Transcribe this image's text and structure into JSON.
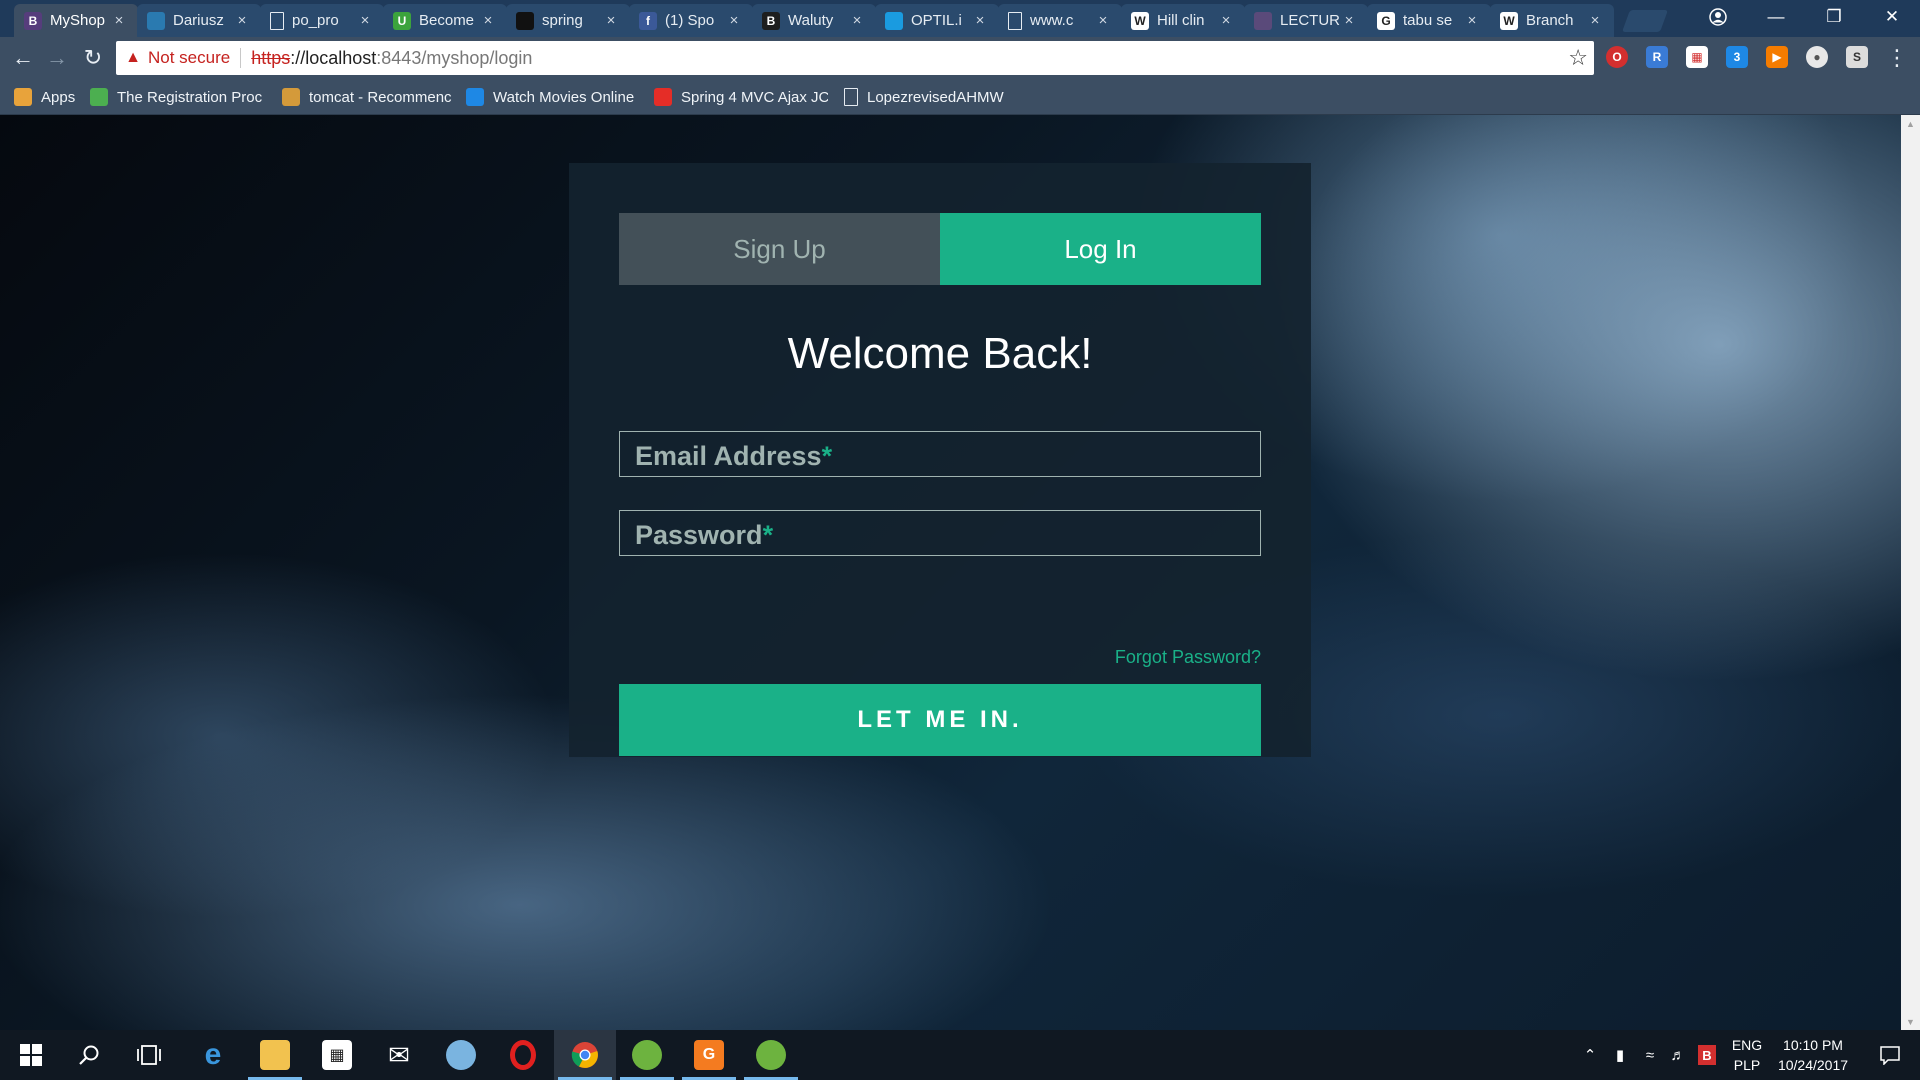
{
  "browser": {
    "tabs": [
      {
        "title": "MyShop",
        "icon": "bootstrap-icon",
        "icon_text": "B",
        "icon_color": "#563d7c",
        "active": true
      },
      {
        "title": "Dariusz",
        "icon": "profile-photo-icon",
        "icon_text": "",
        "icon_color": "#2a7ab0",
        "active": false
      },
      {
        "title": "po_pro",
        "icon": "document-icon",
        "icon_text": "",
        "icon_color": "",
        "active": false
      },
      {
        "title": "Become",
        "icon": "udemy-icon",
        "icon_text": "U",
        "icon_color": "#3ca33c",
        "active": false
      },
      {
        "title": "spring",
        "icon": "github-icon",
        "icon_text": "",
        "icon_color": "#111111",
        "active": false
      },
      {
        "title": "(1) Spo",
        "icon": "facebook-icon",
        "icon_text": "f",
        "icon_color": "#3b5998",
        "active": false
      },
      {
        "title": "Waluty",
        "icon": "bootstrap-icon",
        "icon_text": "B",
        "icon_color": "#1e1e1e",
        "active": false
      },
      {
        "title": "OPTIL.i",
        "icon": "optil-icon",
        "icon_text": "",
        "icon_color": "#1a9be0",
        "active": false
      },
      {
        "title": "www.c",
        "icon": "document-icon",
        "icon_text": "",
        "icon_color": "",
        "active": false
      },
      {
        "title": "Hill clin",
        "icon": "wikipedia-icon",
        "icon_text": "W",
        "icon_color": "#ffffff",
        "active": false
      },
      {
        "title": "LECTUR",
        "icon": "lecture-icon",
        "icon_text": "",
        "icon_color": "#5a4a7a",
        "active": false
      },
      {
        "title": "tabu se",
        "icon": "google-icon",
        "icon_text": "G",
        "icon_color": "#ffffff",
        "active": false
      },
      {
        "title": "Branch",
        "icon": "wikipedia-icon",
        "icon_text": "W",
        "icon_color": "#ffffff",
        "active": false
      }
    ],
    "close_glyph": "×",
    "address": {
      "security_label": "Not secure",
      "url_scheme": "https",
      "url_host": "://localhost",
      "url_rest": ":8443/myshop/login"
    },
    "bookmarks": [
      {
        "label": "Apps",
        "icon": "apps-grid-icon",
        "color": "#e8a33b"
      },
      {
        "label": "The Registration Proc",
        "icon": "registration-icon",
        "color": "#4caf50"
      },
      {
        "label": "tomcat - Recommenc",
        "icon": "tomcat-icon",
        "color": "#d49a3a"
      },
      {
        "label": "Watch Movies Online",
        "icon": "movies-icon",
        "color": "#1e88e5"
      },
      {
        "label": "Spring 4 MVC Ajax JC",
        "icon": "youtube-icon",
        "color": "#e52d27"
      },
      {
        "label": "LopezrevisedAHMW",
        "icon": "document-icon",
        "color": ""
      }
    ]
  },
  "login": {
    "tab_signup": "Sign Up",
    "tab_login": "Log In",
    "heading": "Welcome Back!",
    "email_placeholder": "Email Address",
    "password_placeholder": "Password",
    "required_mark": "*",
    "forgot_link": "Forgot Password?",
    "submit_label": "LET ME IN.",
    "accent_color": "#1ab188"
  },
  "taskbar": {
    "language_line1": "ENG",
    "language_line2": "PLP",
    "time": "10:10 PM",
    "date": "10/24/2017"
  }
}
